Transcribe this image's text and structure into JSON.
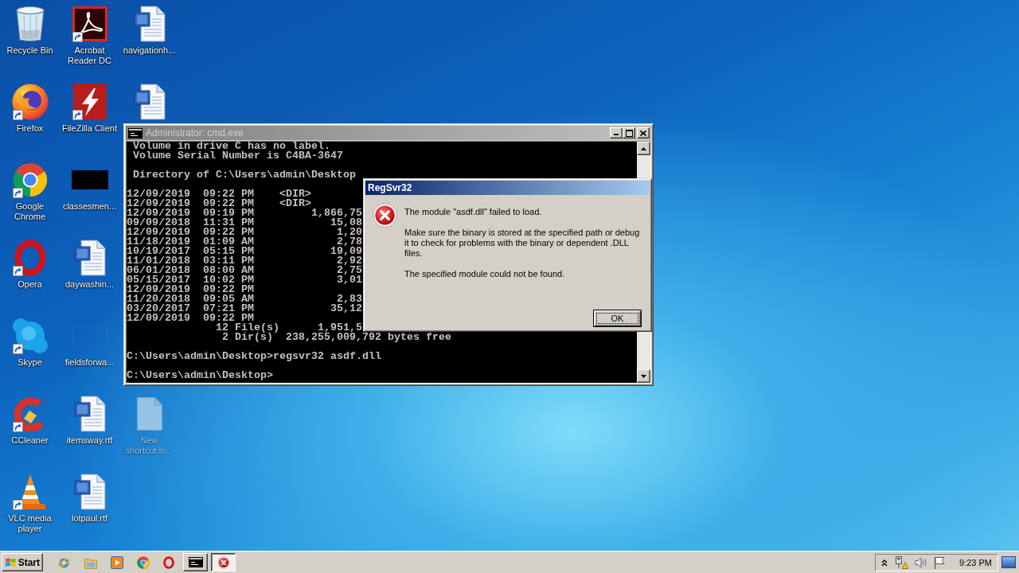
{
  "desktop": {
    "icon_rows": [
      [
        {
          "kind": "recycle_bin",
          "label": "Recycle Bin",
          "shortcut": false,
          "dimmed": false
        },
        {
          "kind": "acrobat",
          "label": "Acrobat Reader DC",
          "shortcut": true,
          "dimmed": false
        },
        {
          "kind": "word",
          "label": "navigationh...",
          "shortcut": false,
          "dimmed": false
        }
      ],
      [
        {
          "kind": "firefox",
          "label": "Firefox",
          "shortcut": true,
          "dimmed": false
        },
        {
          "kind": "filezilla",
          "label": "FileZilla Client",
          "shortcut": true,
          "dimmed": false
        },
        {
          "kind": "word",
          "shortcut": false,
          "dimmed": false
        }
      ],
      [
        {
          "kind": "chrome",
          "label": "Google Chrome",
          "shortcut": true,
          "dimmed": false
        },
        {
          "kind": "dark_thumbnail",
          "label": "classesmen...",
          "shortcut": false,
          "dimmed": false
        }
      ],
      [
        {
          "kind": "opera",
          "label": "Opera",
          "shortcut": true,
          "dimmed": false
        },
        {
          "kind": "word",
          "label": "daywashin...",
          "shortcut": false,
          "dimmed": false
        }
      ],
      [
        {
          "kind": "skype",
          "label": "Skype",
          "shortcut": true,
          "dimmed": false
        },
        {
          "kind": "light_thumbnail",
          "label": "fieldsforwa...",
          "shortcut": false,
          "dimmed": false
        }
      ],
      [
        {
          "kind": "ccleaner",
          "label": "CCleaner",
          "shortcut": true,
          "dimmed": false
        },
        {
          "kind": "word",
          "label": "itemsway.rtf",
          "shortcut": false,
          "dimmed": false
        },
        {
          "kind": "blank_file",
          "label": "New shortcut.ln...",
          "shortcut": false,
          "dimmed": true
        }
      ],
      [
        {
          "kind": "vlc",
          "label": "VLC media player",
          "shortcut": true,
          "dimmed": false
        },
        {
          "kind": "word",
          "label": "lotpaul.rtf",
          "shortcut": false,
          "dimmed": false
        }
      ]
    ]
  },
  "console_window": {
    "title": "Administrator: cmd.exe",
    "active": false,
    "blocks": [
      [
        " Volume in drive C has no label.",
        " Volume Serial Number is C4BA-3647"
      ],
      [
        " Directory of C:\\Users\\admin\\Desktop"
      ],
      [
        "12/09/2019  09:22 PM    <DIR>",
        "12/09/2019  09:22 PM    <DIR>",
        "12/09/2019  09:19 PM         1,866,75",
        "09/09/2018  11:31 PM            15,08",
        "12/09/2019  09:22 PM             1,20",
        "11/18/2019  01:09 AM             2,78",
        "10/19/2017  05:15 PM            19,09",
        "11/01/2018  03:11 PM             2,92",
        "06/01/2018  08:00 AM             2,75",
        "05/15/2017  10:02 PM             3,01",
        "12/09/2019  09:22 PM",
        "11/20/2018  09:05 AM             2,83",
        "03/20/2017  07:21 PM            35,12",
        "12/09/2019  09:22 PM",
        "              12 File(s)      1,951,5",
        "               2 Dir(s)  238,255,009,792 bytes free"
      ],
      [
        "C:\\Users\\admin\\Desktop>regsvr32 asdf.dll"
      ],
      [
        "C:\\Users\\admin\\Desktop>"
      ]
    ]
  },
  "dialog": {
    "title": "RegSvr32",
    "active": true,
    "paragraphs": [
      "The module \"asdf.dll\" failed to load.",
      "Make sure the binary is stored at the specified path or debug it to check for problems with the binary or dependent .DLL files.",
      "The specified module could not be found."
    ],
    "buttons": [
      {
        "label": "OK",
        "focused": true
      }
    ]
  },
  "taskbar": {
    "start_label": "Start",
    "tasks": [
      {
        "kind": "console",
        "selected": false
      },
      {
        "kind": "error",
        "selected": true
      }
    ],
    "clock": "9:23 PM"
  }
}
